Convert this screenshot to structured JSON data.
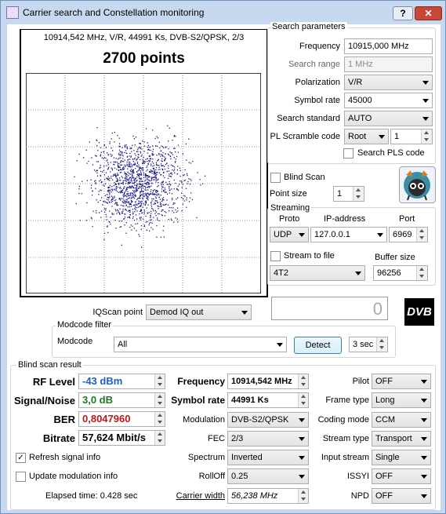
{
  "window": {
    "title": "Carrier search and Constellation monitoring",
    "help_label": "?",
    "close_label": "✕"
  },
  "constellation": {
    "info": "10914,542 MHz, V/R, 44991 Ks, DVB-S2/QPSK, 2/3",
    "points_label": "2700 points",
    "dot_color": "#1a1a8a"
  },
  "search": {
    "group_label": "Search parameters",
    "frequency_label": "Frequency",
    "frequency_value": "10915,000 MHz",
    "range_label": "Search range",
    "range_value": "1 MHz",
    "polarization_label": "Polarization",
    "polarization_value": "V/R",
    "symbol_rate_label": "Symbol rate",
    "symbol_rate_value": "45000",
    "standard_label": "Search standard",
    "standard_value": "AUTO",
    "pls_label": "PL Scramble code",
    "pls_mode": "Root",
    "pls_value": "1",
    "search_pls_label": "Search PLS code"
  },
  "blind": {
    "blind_scan_label": "Blind Scan",
    "point_size_label": "Point size",
    "point_size_value": "1"
  },
  "streaming": {
    "group_label": "Streaming",
    "proto_label": "Proto",
    "ip_label": "IP-address",
    "port_label": "Port",
    "proto_value": "UDP",
    "ip_value": "127.0.0.1",
    "port_value": "6969",
    "stream_to_file_label": "Stream to file",
    "buffer_size_label": "Buffer size",
    "file_mode": "4T2",
    "buffer_value": "96256"
  },
  "iq": {
    "label": "IQScan point",
    "value": "Demod IQ out",
    "counter": "0"
  },
  "logo": {
    "text": "DVB"
  },
  "modcode": {
    "group_label": "Modcode filter",
    "label": "Modcode",
    "value": "All",
    "detect_label": "Detect",
    "time_value": "3 sec"
  },
  "result": {
    "group_label": "Blind scan result",
    "rf_label": "RF Level",
    "rf_value": "-43 dBm",
    "sn_label": "Signal/Noise",
    "sn_value": "3,0 dB",
    "ber_label": "BER",
    "ber_value": "0,8047960",
    "bitrate_label": "Bitrate",
    "bitrate_value": "57,624 Mbit/s",
    "refresh_label": "Refresh signal info",
    "update_label": "Update modulation info",
    "elapsed": "Elapsed time: 0.428 sec",
    "freq_label": "Frequency",
    "freq_value": "10914,542 MHz",
    "sr_label": "Symbol rate",
    "sr_value": "44991 Ks",
    "mod_label": "Modulation",
    "mod_value": "DVB-S2/QPSK",
    "fec_label": "FEC",
    "fec_value": "2/3",
    "spectrum_label": "Spectrum",
    "spectrum_value": "Inverted",
    "rolloff_label": "RollOff",
    "rolloff_value": "0.25",
    "cw_label": "Carrier width",
    "cw_value": "56,238 MHz",
    "pilot_label": "Pilot",
    "pilot_value": "OFF",
    "frame_label": "Frame type",
    "frame_value": "Long",
    "coding_label": "Coding mode",
    "coding_value": "CCM",
    "stream_type_label": "Stream type",
    "stream_type_value": "Transport",
    "input_stream_label": "Input stream",
    "input_stream_value": "Single",
    "issyi_label": "ISSYI",
    "issyi_value": "OFF",
    "npd_label": "NPD",
    "npd_value": "OFF",
    "colors": {
      "rf": "#1f5fbf",
      "sn": "#1e7a1e",
      "ber": "#c01818"
    }
  }
}
